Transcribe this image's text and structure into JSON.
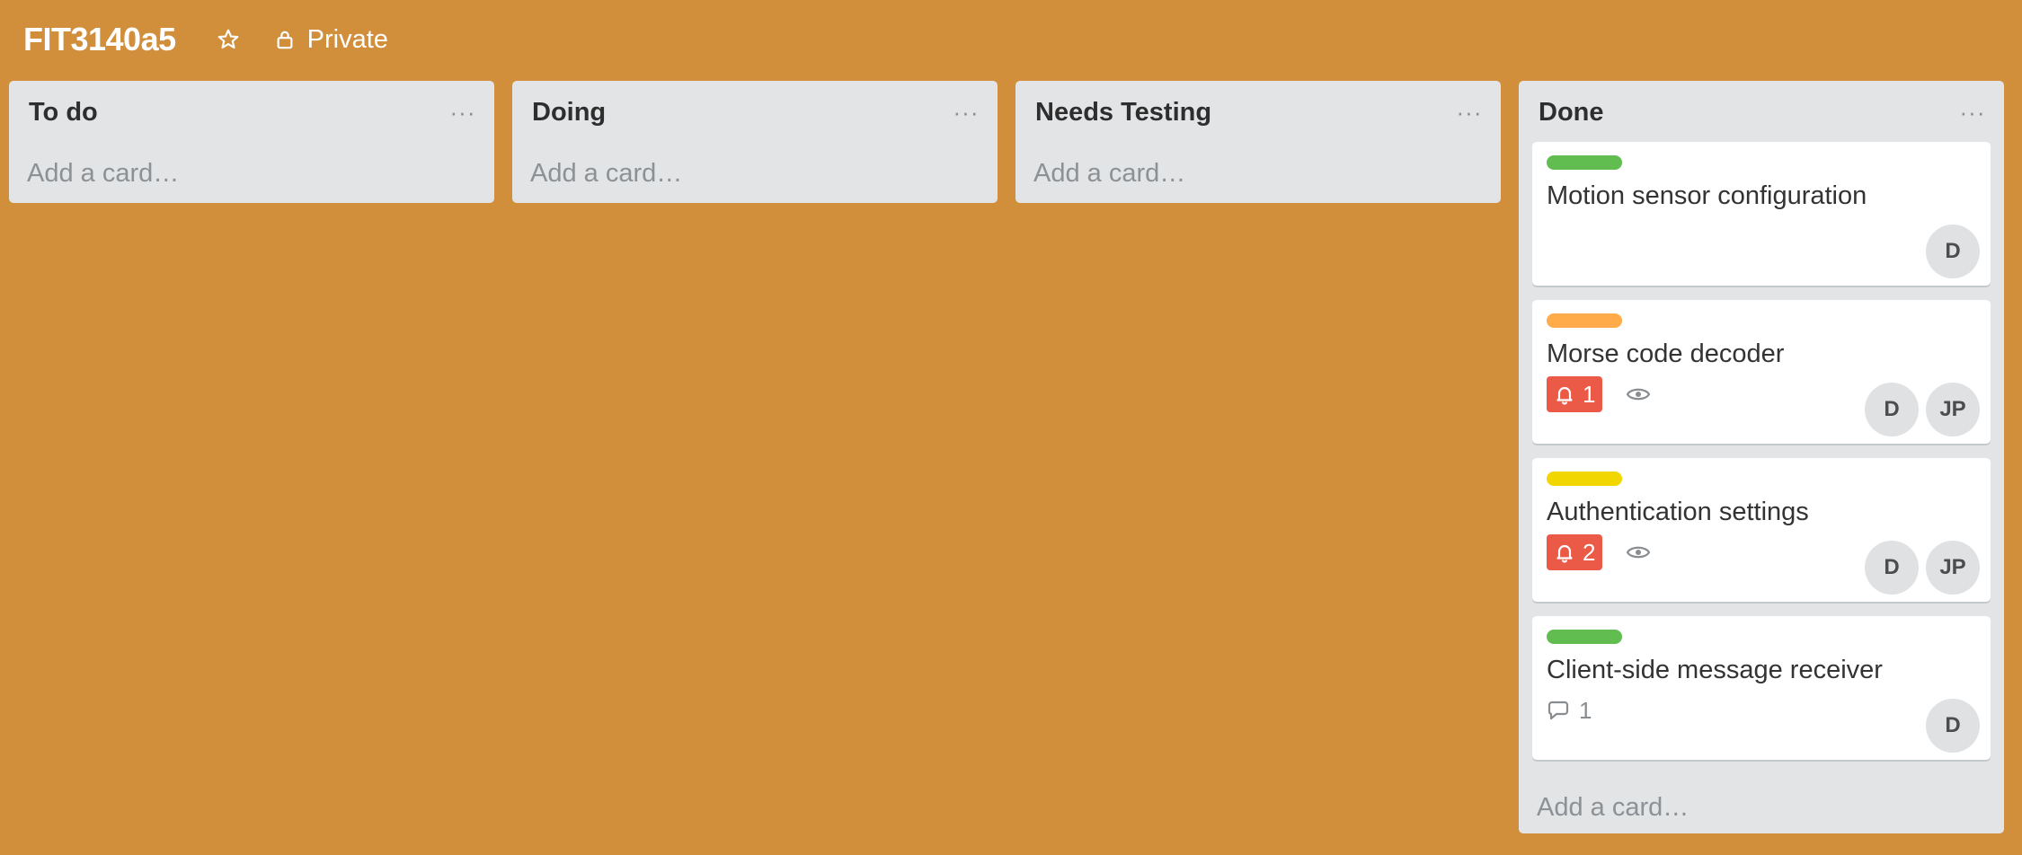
{
  "header": {
    "board_title": "FIT3140a5",
    "visibility_label": "Private"
  },
  "lists": [
    {
      "title": "To do",
      "add_card_label": "Add a card…"
    },
    {
      "title": "Doing",
      "add_card_label": "Add a card…"
    },
    {
      "title": "Needs Testing",
      "add_card_label": "Add a card…"
    },
    {
      "title": "Done",
      "add_card_label": "Add a card…",
      "cards": [
        {
          "title": "Motion sensor configuration",
          "label_color": "#61bd4f",
          "members": [
            "D"
          ]
        },
        {
          "title": "Morse code decoder",
          "label_color": "#ffab4a",
          "notification_count": "1",
          "members": [
            "D",
            "JP"
          ]
        },
        {
          "title": "Authentication settings",
          "label_color": "#f2d600",
          "notification_count": "2",
          "members": [
            "D",
            "JP"
          ]
        },
        {
          "title": "Client-side message receiver",
          "label_color": "#61bd4f",
          "comment_count": "1",
          "members": [
            "D"
          ]
        }
      ]
    }
  ],
  "colors": {
    "background": "#d18f3b",
    "list_bg": "#e2e4e6",
    "notification_badge": "#eb5a46"
  },
  "icons": {
    "star": "star-icon",
    "lock": "lock-icon",
    "menu": "ellipsis-icon",
    "bell": "bell-icon",
    "eye": "eye-icon",
    "comment": "comment-icon"
  }
}
